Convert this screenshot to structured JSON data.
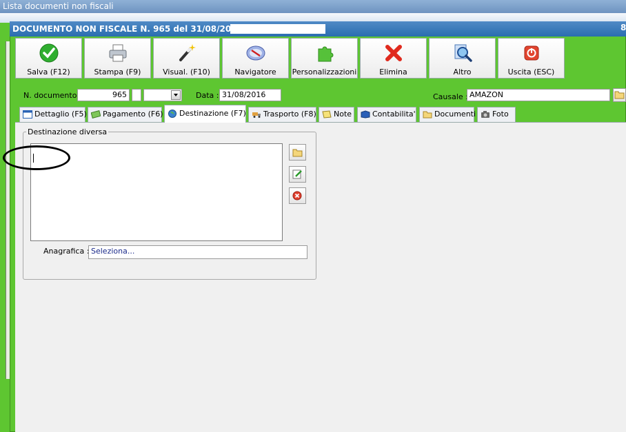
{
  "background_window": {
    "title": "Lista documenti non fiscali"
  },
  "dialog": {
    "title": "DOCUMENTO NON FISCALE N. 965 del 31/08/2016 -",
    "close_glyph": "8"
  },
  "toolbar": [
    {
      "label": "Salva (F12)",
      "icon": "check-icon"
    },
    {
      "label": "Stampa (F9)",
      "icon": "printer-icon"
    },
    {
      "label": "Visual. (F10)",
      "icon": "magic-wand-icon"
    },
    {
      "label": "Navigatore",
      "icon": "compass-icon"
    },
    {
      "label": "Personalizzazioni",
      "icon": "puzzle-icon"
    },
    {
      "label": "Elimina",
      "icon": "delete-x-icon"
    },
    {
      "label": "Altro",
      "icon": "magnifier-icon"
    },
    {
      "label": "Uscita (ESC)",
      "icon": "power-icon"
    }
  ],
  "fields": {
    "ndoc_label": "N. documento :",
    "ndoc_value": "965",
    "data_label": "Data :",
    "data_value": "31/08/2016",
    "causale_label": "Causale :",
    "causale_value": "AMAZON"
  },
  "tabs": [
    {
      "label": "Dettaglio (F5)"
    },
    {
      "label": "Pagamento (F6)"
    },
    {
      "label": "Destinazione (F7)",
      "active": true
    },
    {
      "label": "Trasporto (F8)"
    },
    {
      "label": "Note"
    },
    {
      "label": "Contabilita'"
    },
    {
      "label": "Documenti"
    },
    {
      "label": "Foto"
    }
  ],
  "destinazione": {
    "group_label": "Destinazione diversa",
    "anagrafica_label": "Anagrafica :",
    "anagrafica_value": "Seleziona..."
  },
  "colors": {
    "dialog_green": "#5ec631",
    "title_blue": "#2a6db0",
    "panel_grey": "#f0f0f0"
  }
}
